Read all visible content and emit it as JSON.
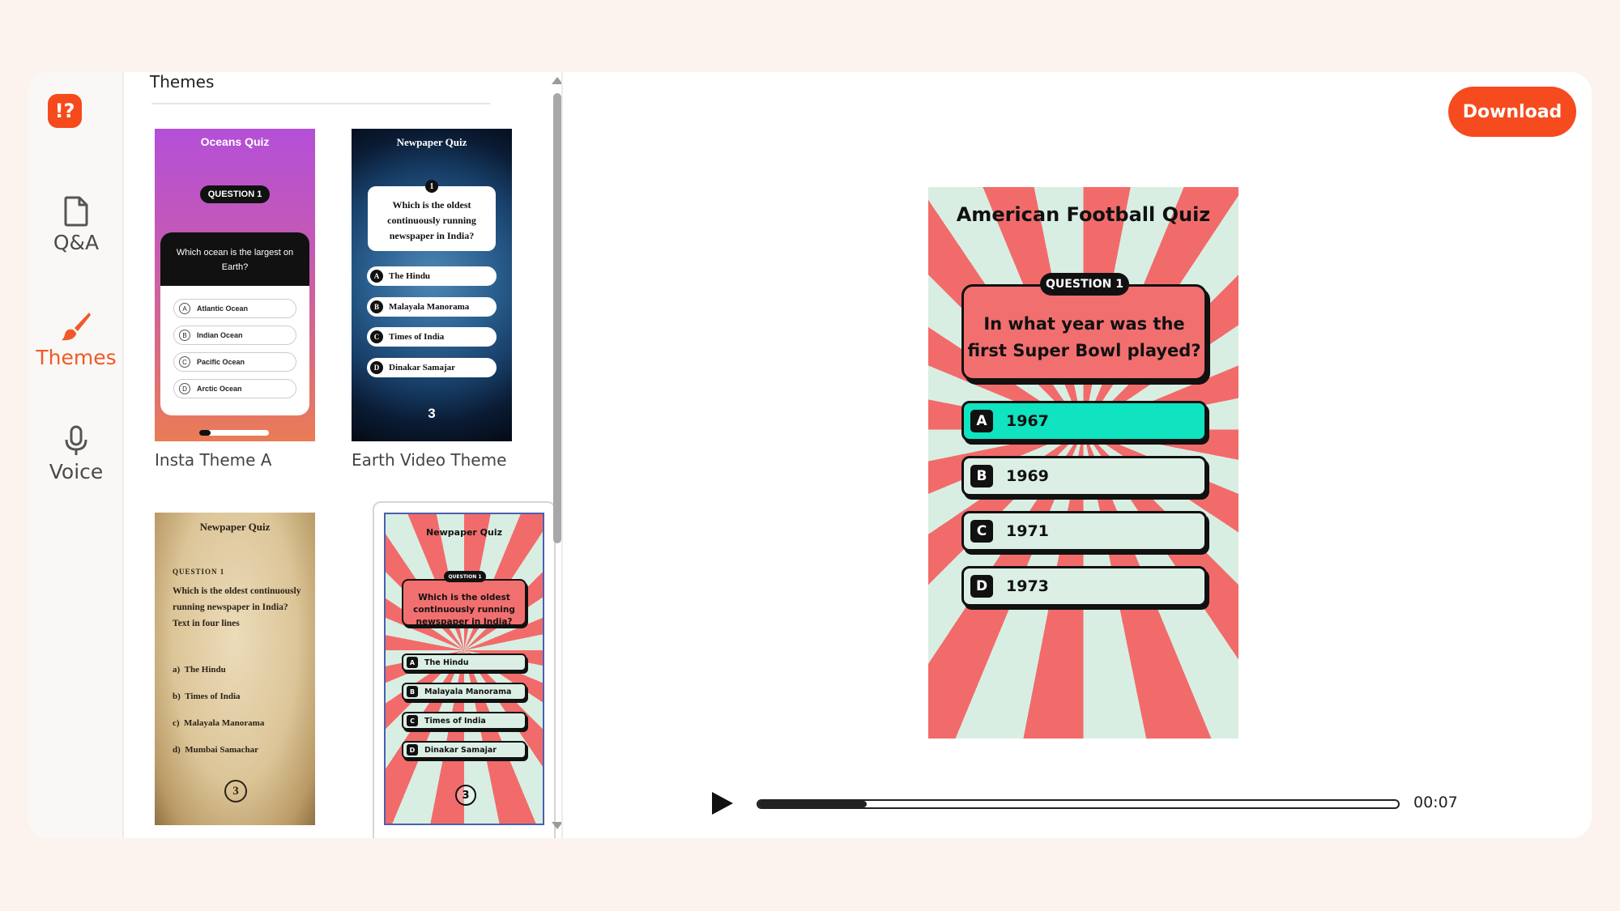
{
  "app": {
    "logo_text": "!?",
    "accent": "#f54b1e"
  },
  "sidebar": {
    "items": [
      {
        "label": "Q&A",
        "icon": "document-icon",
        "active": false
      },
      {
        "label": "Themes",
        "icon": "paintbrush-icon",
        "active": true
      },
      {
        "label": "Voice",
        "icon": "microphone-icon",
        "active": false
      }
    ]
  },
  "themes_panel": {
    "title": "Themes",
    "cards": [
      {
        "label": "Insta Theme A",
        "thumb": {
          "title": "Oceans Quiz",
          "question_label": "QUESTION 1",
          "question": "Which ocean is the largest on Earth?",
          "options": [
            {
              "letter": "A",
              "text": "Atlantic Ocean"
            },
            {
              "letter": "B",
              "text": "Indian Ocean"
            },
            {
              "letter": "C",
              "text": "Pacific Ocean"
            },
            {
              "letter": "D",
              "text": "Arctic Ocean"
            }
          ]
        }
      },
      {
        "label": "Earth Video Theme",
        "thumb": {
          "title": "Newpaper Quiz",
          "number": "1",
          "question": "Which is the oldest continuously running newspaper in India?",
          "options": [
            {
              "letter": "A",
              "text": "The Hindu"
            },
            {
              "letter": "B",
              "text": "Malayala Manorama"
            },
            {
              "letter": "C",
              "text": "Times of India"
            },
            {
              "letter": "D",
              "text": "Dinakar Samajar"
            }
          ],
          "timer": "3"
        }
      },
      {
        "label": "",
        "thumb": {
          "title": "Newpaper Quiz",
          "question_label": "QUESTION 1",
          "question": "Which is the oldest continuously running newspaper in India? Text in four lines",
          "options": [
            {
              "letter": "a)",
              "text": "The Hindu"
            },
            {
              "letter": "b)",
              "text": "Times of India"
            },
            {
              "letter": "c)",
              "text": "Malayala Manorama"
            },
            {
              "letter": "d)",
              "text": "Mumbai Samachar"
            }
          ],
          "timer": "3"
        }
      },
      {
        "label": "",
        "selected": true,
        "thumb": {
          "title": "Newpaper Quiz",
          "question_label": "QUESTION 1",
          "question": "Which is the oldest continuously running newspaper in India?",
          "options": [
            {
              "letter": "A",
              "text": "The Hindu"
            },
            {
              "letter": "B",
              "text": "Malayala Manorama"
            },
            {
              "letter": "C",
              "text": "Times of India"
            },
            {
              "letter": "D",
              "text": "Dinakar Samajar"
            }
          ],
          "timer": "3"
        }
      }
    ]
  },
  "header": {
    "download_label": "Download"
  },
  "preview": {
    "title": "American Football Quiz",
    "question_label": "QUESTION 1",
    "question": "In what year was the first Super Bowl played?",
    "options": [
      {
        "letter": "A",
        "text": "1967",
        "highlighted": true
      },
      {
        "letter": "B",
        "text": "1969",
        "highlighted": false
      },
      {
        "letter": "C",
        "text": "1971",
        "highlighted": false
      },
      {
        "letter": "D",
        "text": "1973",
        "highlighted": false
      }
    ],
    "highlight_color": "#0fe3c0"
  },
  "player": {
    "time": "00:07",
    "progress": 0.17
  }
}
